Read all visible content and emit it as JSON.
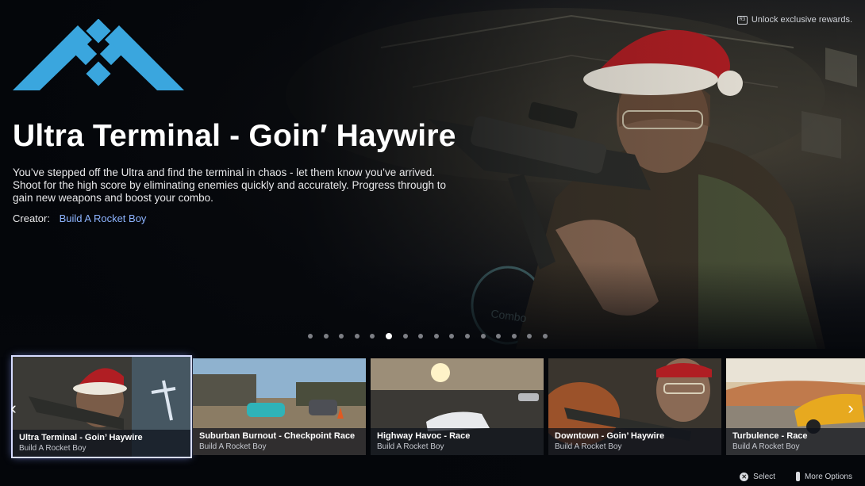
{
  "header": {
    "unlock_icon": "r3-button-icon",
    "unlock_text": "Unlock exclusive rewards."
  },
  "hero": {
    "title": "Ultra Terminal - Goin′ Haywire",
    "description": "You’ve stepped off the Ultra and find the terminal in chaos - let them know you’ve arrived. Shoot for the high score by eliminating enemies quickly and accurately. Progress through to gain new weapons and boost your combo.",
    "creator_label": "Creator:",
    "creator_name": "Build A Rocket Boy"
  },
  "pagination": {
    "total": 16,
    "active_index": 5
  },
  "carousel": {
    "items": [
      {
        "title": "Ultra Terminal - Goin’ Haywire",
        "creator": "Build A Rocket Boy",
        "selected": true
      },
      {
        "title": "Suburban Burnout - Checkpoint Race",
        "creator": "Build A Rocket Boy",
        "selected": false
      },
      {
        "title": "Highway Havoc - Race",
        "creator": "Build A Rocket Boy",
        "selected": false
      },
      {
        "title": "Downtown - Goin’ Haywire",
        "creator": "Build A Rocket Boy",
        "selected": false
      },
      {
        "title": "Turbulence - Race",
        "creator": "Build A Rocket Boy",
        "selected": false
      }
    ],
    "prev_icon": "chevron-left-icon",
    "next_icon": "chevron-right-icon"
  },
  "footer": {
    "select_icon": "cross-button-icon",
    "select_label": "Select",
    "options_icon": "touchpad-icon",
    "options_label": "More Options"
  },
  "colors": {
    "accent": "#8db4ff",
    "logo": "#3aa6de",
    "selection_outline": "#d7dcff"
  }
}
